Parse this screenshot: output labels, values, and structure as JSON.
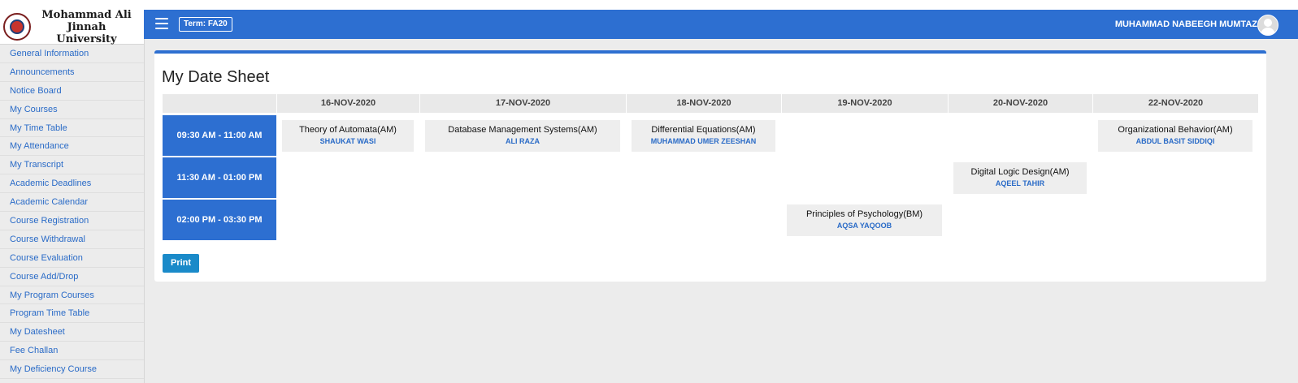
{
  "sidebar": {
    "university_line1": "Mohammad Ali Jinnah",
    "university_line2": "University",
    "logo_icon": "university-seal-icon",
    "items": [
      {
        "label": "General Information"
      },
      {
        "label": "Announcements"
      },
      {
        "label": "Notice Board"
      },
      {
        "label": "My Courses"
      },
      {
        "label": "My Time Table"
      },
      {
        "label": "My Attendance"
      },
      {
        "label": "My Transcript"
      },
      {
        "label": "Academic Deadlines"
      },
      {
        "label": "Academic Calendar"
      },
      {
        "label": "Course Registration"
      },
      {
        "label": "Course Withdrawal"
      },
      {
        "label": "Course Evaluation"
      },
      {
        "label": "Course Add/Drop"
      },
      {
        "label": "My Program Courses"
      },
      {
        "label": "Program Time Table"
      },
      {
        "label": "My Datesheet"
      },
      {
        "label": "Fee Challan"
      },
      {
        "label": "My Deficiency Course"
      }
    ]
  },
  "header": {
    "term": "Term: FA20",
    "user_name": "MUHAMMAD NABEEGH MUMTAZ",
    "menu_icon": "hamburger-menu-icon",
    "avatar_icon": "user-avatar-icon"
  },
  "datesheet": {
    "title": "My Date Sheet",
    "dates": [
      "16-NOV-2020",
      "17-NOV-2020",
      "18-NOV-2020",
      "19-NOV-2020",
      "20-NOV-2020",
      "22-NOV-2020"
    ],
    "slots": [
      "09:30 AM - 11:00 AM",
      "11:30 AM - 01:00 PM",
      "02:00 PM - 03:30 PM"
    ],
    "exams": [
      {
        "date_index": 0,
        "slot_index": 0,
        "course": "Theory of Automata(AM)",
        "teacher": "SHAUKAT WASI"
      },
      {
        "date_index": 1,
        "slot_index": 0,
        "course": "Database Management Systems(AM)",
        "teacher": "ALI RAZA"
      },
      {
        "date_index": 2,
        "slot_index": 0,
        "course": "Differential Equations(AM)",
        "teacher": "MUHAMMAD UMER ZEESHAN"
      },
      {
        "date_index": 5,
        "slot_index": 0,
        "course": "Organizational Behavior(AM)",
        "teacher": "ABDUL BASIT SIDDIQI"
      },
      {
        "date_index": 4,
        "slot_index": 1,
        "course": "Digital Logic Design(AM)",
        "teacher": "AQEEL TAHIR"
      },
      {
        "date_index": 3,
        "slot_index": 2,
        "course": "Principles of Psychology(BM)",
        "teacher": "AQSA YAQOOB"
      }
    ],
    "print_label": "Print"
  },
  "colors": {
    "primary": "#2d6fd1",
    "link": "#2a6bc7",
    "print_button": "#1a8ac9"
  }
}
